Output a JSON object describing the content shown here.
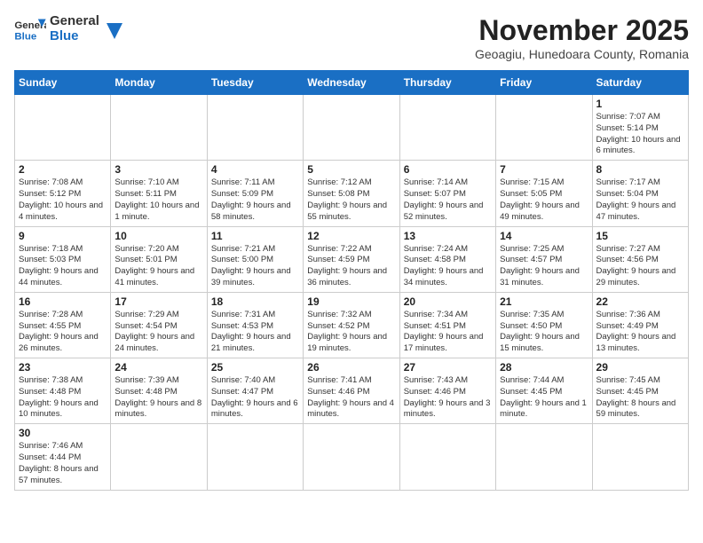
{
  "logo": {
    "text_general": "General",
    "text_blue": "Blue"
  },
  "title": "November 2025",
  "subtitle": "Geoagiu, Hunedoara County, Romania",
  "days_of_week": [
    "Sunday",
    "Monday",
    "Tuesday",
    "Wednesday",
    "Thursday",
    "Friday",
    "Saturday"
  ],
  "weeks": [
    [
      {
        "num": "",
        "info": ""
      },
      {
        "num": "",
        "info": ""
      },
      {
        "num": "",
        "info": ""
      },
      {
        "num": "",
        "info": ""
      },
      {
        "num": "",
        "info": ""
      },
      {
        "num": "",
        "info": ""
      },
      {
        "num": "1",
        "info": "Sunrise: 7:07 AM\nSunset: 5:14 PM\nDaylight: 10 hours and 6 minutes."
      }
    ],
    [
      {
        "num": "2",
        "info": "Sunrise: 7:08 AM\nSunset: 5:12 PM\nDaylight: 10 hours and 4 minutes."
      },
      {
        "num": "3",
        "info": "Sunrise: 7:10 AM\nSunset: 5:11 PM\nDaylight: 10 hours and 1 minute."
      },
      {
        "num": "4",
        "info": "Sunrise: 7:11 AM\nSunset: 5:09 PM\nDaylight: 9 hours and 58 minutes."
      },
      {
        "num": "5",
        "info": "Sunrise: 7:12 AM\nSunset: 5:08 PM\nDaylight: 9 hours and 55 minutes."
      },
      {
        "num": "6",
        "info": "Sunrise: 7:14 AM\nSunset: 5:07 PM\nDaylight: 9 hours and 52 minutes."
      },
      {
        "num": "7",
        "info": "Sunrise: 7:15 AM\nSunset: 5:05 PM\nDaylight: 9 hours and 49 minutes."
      },
      {
        "num": "8",
        "info": "Sunrise: 7:17 AM\nSunset: 5:04 PM\nDaylight: 9 hours and 47 minutes."
      }
    ],
    [
      {
        "num": "9",
        "info": "Sunrise: 7:18 AM\nSunset: 5:03 PM\nDaylight: 9 hours and 44 minutes."
      },
      {
        "num": "10",
        "info": "Sunrise: 7:20 AM\nSunset: 5:01 PM\nDaylight: 9 hours and 41 minutes."
      },
      {
        "num": "11",
        "info": "Sunrise: 7:21 AM\nSunset: 5:00 PM\nDaylight: 9 hours and 39 minutes."
      },
      {
        "num": "12",
        "info": "Sunrise: 7:22 AM\nSunset: 4:59 PM\nDaylight: 9 hours and 36 minutes."
      },
      {
        "num": "13",
        "info": "Sunrise: 7:24 AM\nSunset: 4:58 PM\nDaylight: 9 hours and 34 minutes."
      },
      {
        "num": "14",
        "info": "Sunrise: 7:25 AM\nSunset: 4:57 PM\nDaylight: 9 hours and 31 minutes."
      },
      {
        "num": "15",
        "info": "Sunrise: 7:27 AM\nSunset: 4:56 PM\nDaylight: 9 hours and 29 minutes."
      }
    ],
    [
      {
        "num": "16",
        "info": "Sunrise: 7:28 AM\nSunset: 4:55 PM\nDaylight: 9 hours and 26 minutes."
      },
      {
        "num": "17",
        "info": "Sunrise: 7:29 AM\nSunset: 4:54 PM\nDaylight: 9 hours and 24 minutes."
      },
      {
        "num": "18",
        "info": "Sunrise: 7:31 AM\nSunset: 4:53 PM\nDaylight: 9 hours and 21 minutes."
      },
      {
        "num": "19",
        "info": "Sunrise: 7:32 AM\nSunset: 4:52 PM\nDaylight: 9 hours and 19 minutes."
      },
      {
        "num": "20",
        "info": "Sunrise: 7:34 AM\nSunset: 4:51 PM\nDaylight: 9 hours and 17 minutes."
      },
      {
        "num": "21",
        "info": "Sunrise: 7:35 AM\nSunset: 4:50 PM\nDaylight: 9 hours and 15 minutes."
      },
      {
        "num": "22",
        "info": "Sunrise: 7:36 AM\nSunset: 4:49 PM\nDaylight: 9 hours and 13 minutes."
      }
    ],
    [
      {
        "num": "23",
        "info": "Sunrise: 7:38 AM\nSunset: 4:48 PM\nDaylight: 9 hours and 10 minutes."
      },
      {
        "num": "24",
        "info": "Sunrise: 7:39 AM\nSunset: 4:48 PM\nDaylight: 9 hours and 8 minutes."
      },
      {
        "num": "25",
        "info": "Sunrise: 7:40 AM\nSunset: 4:47 PM\nDaylight: 9 hours and 6 minutes."
      },
      {
        "num": "26",
        "info": "Sunrise: 7:41 AM\nSunset: 4:46 PM\nDaylight: 9 hours and 4 minutes."
      },
      {
        "num": "27",
        "info": "Sunrise: 7:43 AM\nSunset: 4:46 PM\nDaylight: 9 hours and 3 minutes."
      },
      {
        "num": "28",
        "info": "Sunrise: 7:44 AM\nSunset: 4:45 PM\nDaylight: 9 hours and 1 minute."
      },
      {
        "num": "29",
        "info": "Sunrise: 7:45 AM\nSunset: 4:45 PM\nDaylight: 8 hours and 59 minutes."
      }
    ],
    [
      {
        "num": "30",
        "info": "Sunrise: 7:46 AM\nSunset: 4:44 PM\nDaylight: 8 hours and 57 minutes."
      },
      {
        "num": "",
        "info": ""
      },
      {
        "num": "",
        "info": ""
      },
      {
        "num": "",
        "info": ""
      },
      {
        "num": "",
        "info": ""
      },
      {
        "num": "",
        "info": ""
      },
      {
        "num": "",
        "info": ""
      }
    ]
  ]
}
